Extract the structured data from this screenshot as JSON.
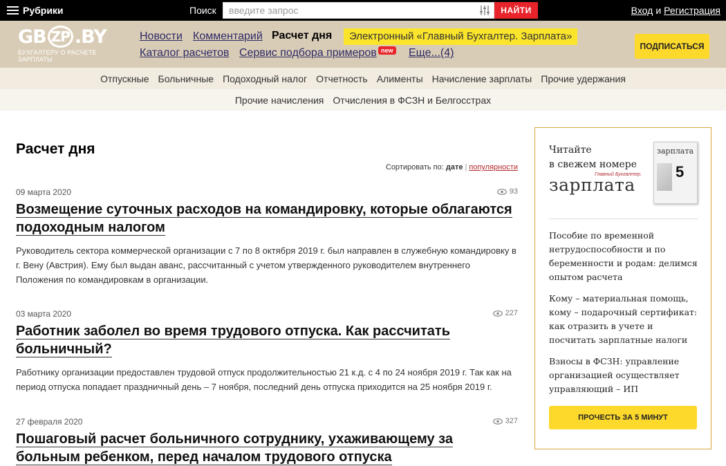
{
  "topbar": {
    "rubrics_label": "Рубрики",
    "search_label": "Поиск",
    "search_placeholder": "введите запрос",
    "search_button": "НАЙТИ",
    "login": "Вход",
    "and": "и",
    "register": "Регистрация"
  },
  "header": {
    "logo_main_left": "GB",
    "logo_main_mid": "ZP",
    "logo_main_right": ".BY",
    "logo_sub": "БУХГАЛТЕРУ О РАСЧЕТЕ ЗАРПЛАТЫ",
    "nav": {
      "news": "Новости",
      "comments": "Комментарий",
      "daily": "Расчет дня",
      "catalog": "Каталог расчетов",
      "service": "Сервис подбора примеров",
      "more": "Еще...(4)"
    },
    "promo": "Электронный «Главный Бухгалтер. Зарплата»",
    "new_badge": "new",
    "subscribe": "ПОДПИСАТЬСЯ"
  },
  "categories_row1": [
    "Отпускные",
    "Больничные",
    "Подоходный налог",
    "Отчетность",
    "Алименты",
    "Начисление зарплаты",
    "Прочие удержания"
  ],
  "categories_row2": [
    "Прочие начисления",
    "Отчисления в ФСЗН и Белгосстрах"
  ],
  "main": {
    "title": "Расчет дня",
    "sort_label": "Сортировать по:",
    "sort_date": "дате",
    "sort_popular": "популярности",
    "articles": [
      {
        "date": "09 марта 2020",
        "views": "93",
        "title": "Возмещение суточных расходов на командировку, которые облагаются подоходным налогом",
        "text": "Руководитель сектора коммерческой организации с 7 по 8 октября 2019 г. был направлен в служебную командировку в г. Вену (Австрия). Ему был выдан аванс, рассчитанный с учетом утвержденного руководителем внутреннего Положения по командировкам в организации."
      },
      {
        "date": "03 марта 2020",
        "views": "227",
        "title": "Работник заболел во время трудового отпуска. Как рассчитать больничный?",
        "text": "Работнику организации предоставлен трудовой отпуск продолжительностью 21 к.д. с 4 по 24 ноября 2019 г. Так как на период отпуска попадает праздничный день – 7 ноября, последний день отпуска приходится на 25 ноября 2019 г."
      },
      {
        "date": "27 февраля 2020",
        "views": "327",
        "title": "Пошаговый расчет больничного сотруднику, ухаживающему за больным ребенком, перед началом трудового отпуска",
        "text": ""
      }
    ]
  },
  "sidebar": {
    "mag_title_line1": "Читайте",
    "mag_title_line2": "в свежем номере",
    "mag_tag": "Главный Бухгалтер.",
    "mag_word": "зарплата",
    "cover_word": "зарплата",
    "cover_num": "5",
    "items": [
      "Пособие по временной нетрудоспособности и по беременности и родам: делимся опытом расчета",
      "Кому – материальная помощь, кому – подарочный сертификат: как отразить в учете и посчитать зарплатные налоги",
      "Взносы в ФСЗН: управление организацией осуществляет управляющий – ИП"
    ],
    "read_button": "ПРОЧЕСТЬ ЗА 5 МИНУТ"
  }
}
